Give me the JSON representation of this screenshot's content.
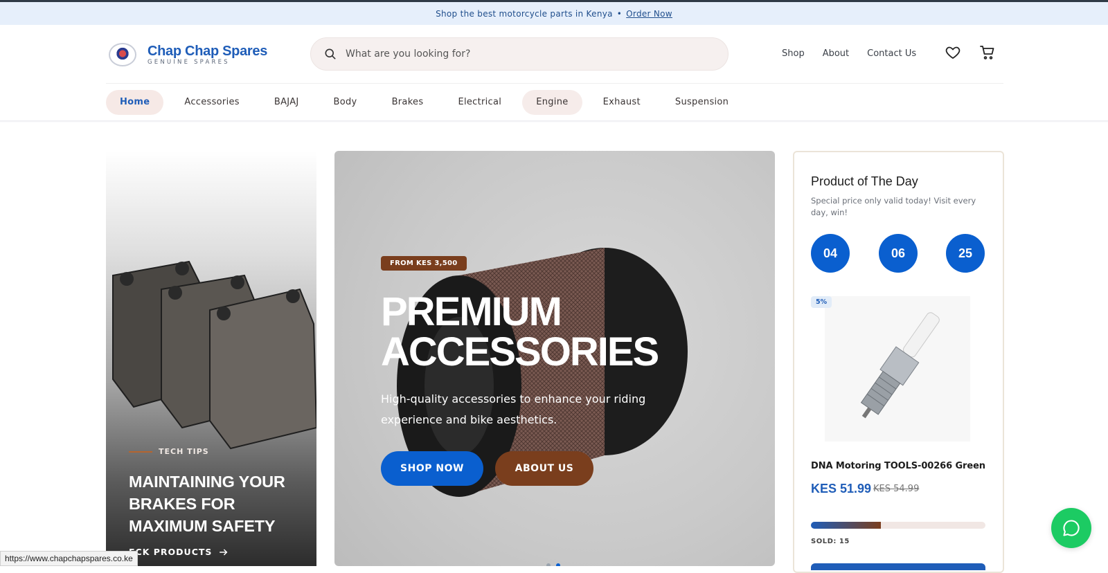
{
  "announcement": {
    "text": "Shop the best motorcycle parts in Kenya",
    "separator": "•",
    "link": "Order Now"
  },
  "brand": {
    "name": "Chap Chap Spares",
    "tagline": "GENUINE SPARES"
  },
  "search": {
    "placeholder": "What are you looking for?"
  },
  "topnav": {
    "items": [
      "Shop",
      "About",
      "Contact Us"
    ]
  },
  "categories": [
    "Home",
    "Accessories",
    "BAJAJ",
    "Body",
    "Brakes",
    "Electrical",
    "Engine",
    "Exhaust",
    "Suspension"
  ],
  "left_card": {
    "kicker": "TECH TIPS",
    "title": "MAINTAINING YOUR BRAKES FOR MAXIMUM SAFETY",
    "cta": "ECK PRODUCTS"
  },
  "hero": {
    "badge": "FROM KES 3,500",
    "title_line1": "PREMIUM",
    "title_line2": "ACCESSORIES",
    "subtitle": "High-quality accessories to enhance your riding experience and bike aesthetics.",
    "primary_cta": "SHOP NOW",
    "secondary_cta": "ABOUT US"
  },
  "product_of_day": {
    "title": "Product of The Day",
    "subtitle": "Special price only valid today! Visit every day, win!",
    "timer": [
      "04",
      "06",
      "25"
    ],
    "discount": "5%",
    "name": "DNA Motoring TOOLS-00266 Green",
    "price": "KES 51.99",
    "old_price": "KES 54.99",
    "sold_label": "SOLD:",
    "sold_count": "15",
    "sold_fraction": 0.4
  },
  "status_url": "https://www.chapchapspares.co.ke",
  "colors": {
    "brand_blue": "#0a5fcf",
    "brand_brown": "#7a3e1d",
    "whatsapp_green": "#1ccb63"
  },
  "icons": [
    "search-icon",
    "heart-icon",
    "cart-icon",
    "arrow-right-icon",
    "whatsapp-chat-icon"
  ]
}
